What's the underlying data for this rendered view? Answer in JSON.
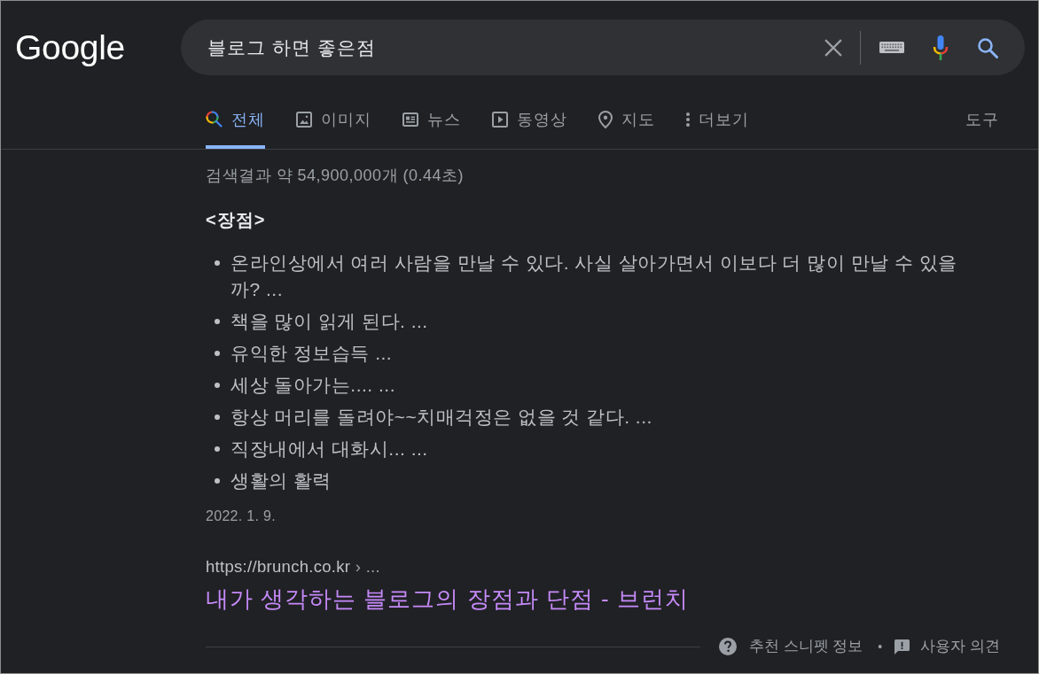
{
  "logo": {
    "text": "Google"
  },
  "search": {
    "value": "블로그 하면 좋은점"
  },
  "tabs": [
    {
      "kind": "search",
      "label": "전체",
      "selected": true
    },
    {
      "kind": "image",
      "label": "이미지",
      "selected": false
    },
    {
      "kind": "news",
      "label": "뉴스",
      "selected": false
    },
    {
      "kind": "video",
      "label": "동영상",
      "selected": false
    },
    {
      "kind": "place",
      "label": "지도",
      "selected": false
    },
    {
      "kind": "more",
      "label": "더보기",
      "selected": false
    }
  ],
  "tools": {
    "label": "도구"
  },
  "result_stats": "검색결과 약 54,900,000개 (0.44초)",
  "snippet": {
    "heading": "<장점>",
    "items": [
      "온라인상에서 여러 사람을 만날 수 있다. 사실 살아가면서 이보다 더 많이 만날 수 있을까? ...",
      "책을 많이 읽게 된다. ...",
      "유익한 정보습득 ...",
      "세상 돌아가는.... ...",
      "항상 머리를 돌려야~~치매걱정은 없을 것 같다. ...",
      "직장내에서 대화시... ...",
      "생활의 활력"
    ],
    "date": "2022. 1. 9."
  },
  "source": {
    "url": "https://brunch.co.kr",
    "path": "› ...",
    "title": "내가 생각하는 블로그의 장점과 단점 - 브런치"
  },
  "footer": {
    "about": "추천 스니펫 정보",
    "separator": "•",
    "feedback": "사용자 의견"
  }
}
